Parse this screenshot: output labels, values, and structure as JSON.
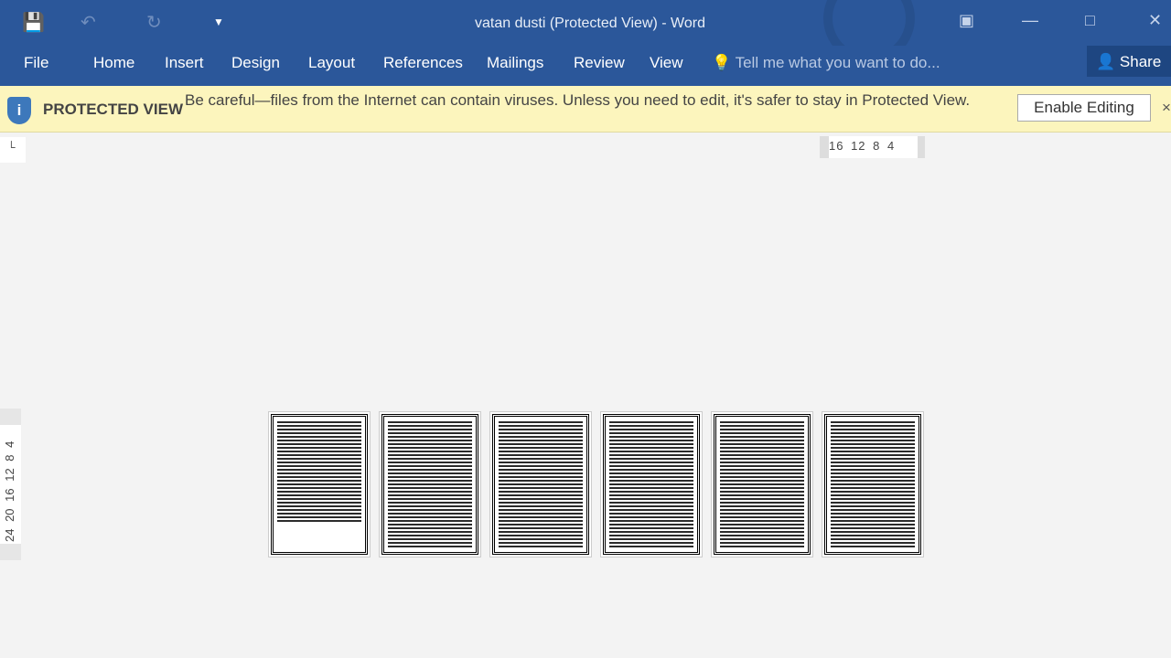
{
  "window": {
    "title": "vatan dusti (Protected View) - Word"
  },
  "quick_access": {
    "save_icon": "save-icon",
    "undo_icon": "undo-icon",
    "redo_icon": "redo-icon",
    "customize_icon": "customize-icon"
  },
  "ribbon": {
    "tabs": [
      "File",
      "Home",
      "Insert",
      "Design",
      "Layout",
      "References",
      "Mailings",
      "Review",
      "View"
    ],
    "tell_me": "Tell me what you want to do...",
    "share": "Share"
  },
  "protected_view": {
    "label": "PROTECTED VIEW",
    "message": "Be careful—files from the Internet can contain viruses. Unless you need to edit, it's safer to stay in Protected View.",
    "enable_button": "Enable Editing",
    "close": "×",
    "icon": "i"
  },
  "rulers": {
    "horizontal": "16 12 8 4",
    "vertical": "24 20 16 12 8 4",
    "tab_selector": "└"
  },
  "colors": {
    "accent": "#2b579a",
    "banner": "#fcf5bd"
  }
}
